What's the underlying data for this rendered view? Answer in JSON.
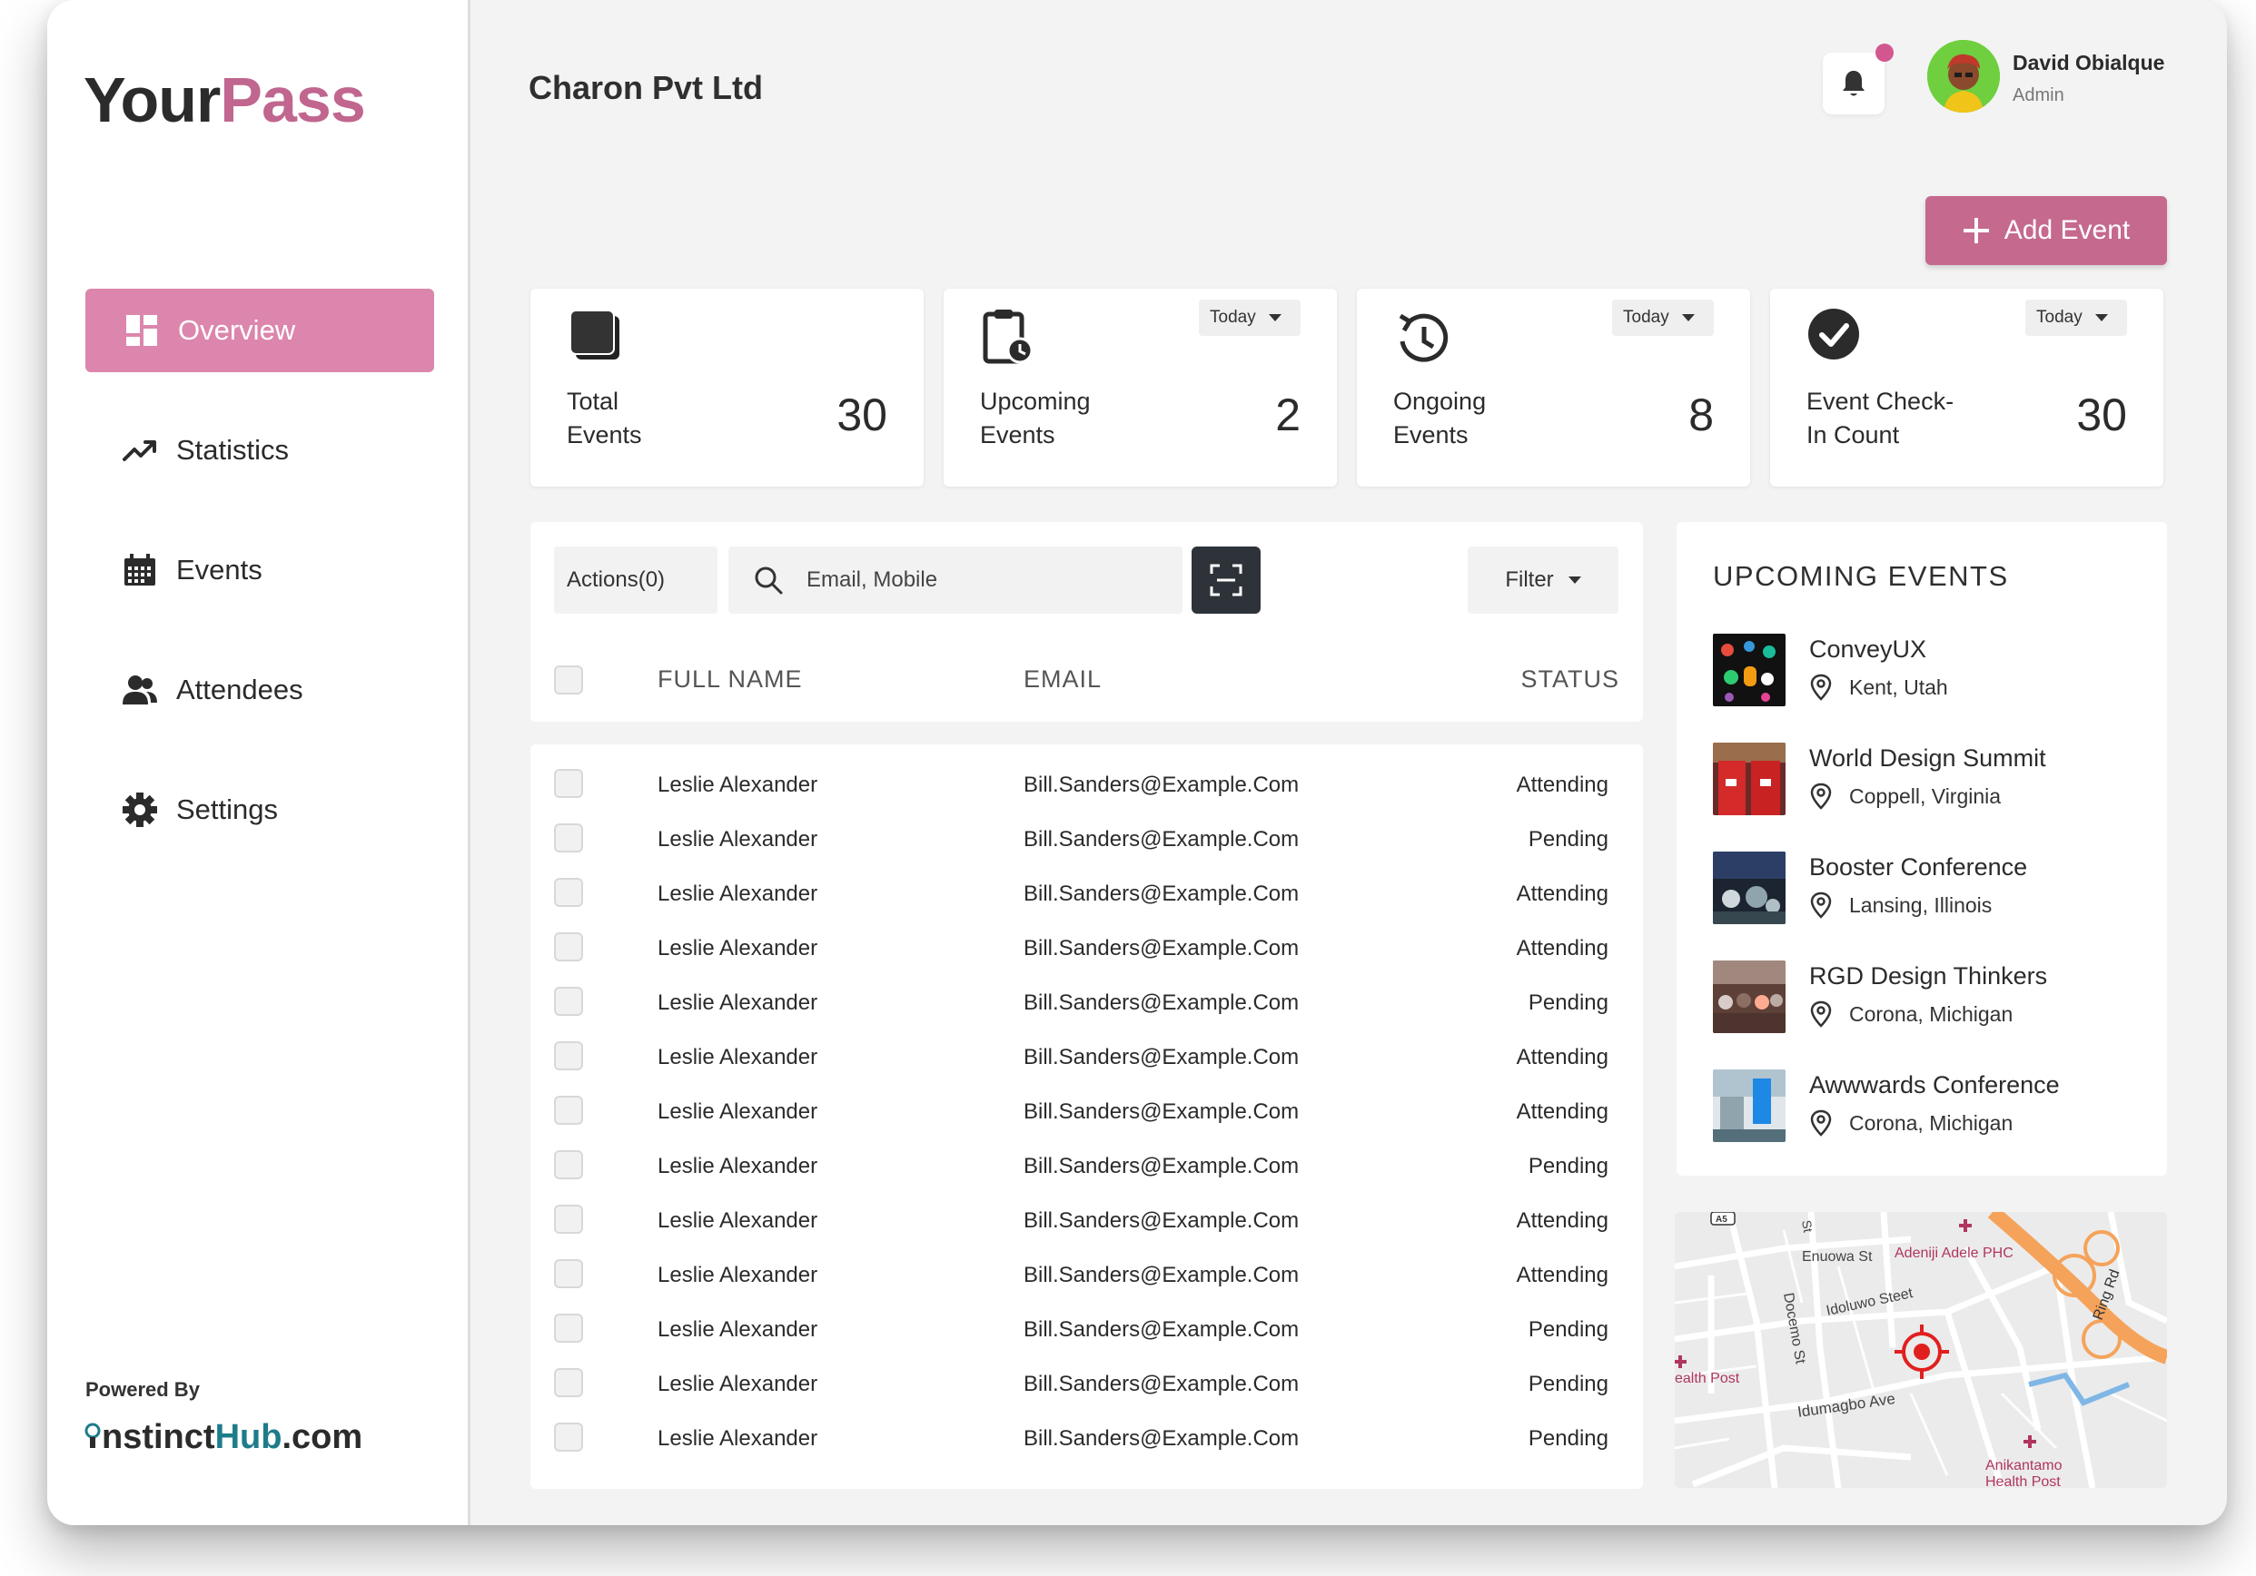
{
  "app": {
    "logo_part1": "Your",
    "logo_part2": "Pass",
    "company": "Charon Pvt Ltd",
    "powered_by": "Powered By",
    "brand_part1": "nstinct",
    "brand_part2": "Hub",
    "brand_part3": ".com"
  },
  "sidebar": {
    "items": [
      {
        "label": "Overview",
        "icon": "grid-icon",
        "active": true
      },
      {
        "label": "Statistics",
        "icon": "trend-up-icon"
      },
      {
        "label": "Events",
        "icon": "calendar-icon"
      },
      {
        "label": "Attendees",
        "icon": "people-icon"
      },
      {
        "label": "Settings",
        "icon": "gear-icon"
      }
    ]
  },
  "user": {
    "name": "David Obialque",
    "role": "Admin"
  },
  "add_event": {
    "label": "Add Event"
  },
  "stats": [
    {
      "label_line1": "Total",
      "label_line2": "Events",
      "value": "30",
      "icon": "square-stack-icon"
    },
    {
      "label_line1": "Upcoming",
      "label_line2": "Events",
      "value": "2",
      "icon": "clipboard-clock-icon",
      "period": "Today"
    },
    {
      "label_line1": "Ongoing",
      "label_line2": "Events",
      "value": "8",
      "icon": "clock-refresh-icon",
      "period": "Today"
    },
    {
      "label_line1": "Event Check-",
      "label_line2": "In Count",
      "value": "30",
      "icon": "check-circle-icon",
      "period": "Today"
    }
  ],
  "toolbar": {
    "actions_label": "Actions(0)",
    "search_placeholder": "Email, Mobile",
    "filter_label": "Filter"
  },
  "table": {
    "columns": [
      "FULL NAME",
      "EMAIL",
      "STATUS"
    ],
    "rows": [
      {
        "name": "Leslie Alexander",
        "email": "Bill.Sanders@Example.Com",
        "status": "Attending"
      },
      {
        "name": "Leslie Alexander",
        "email": "Bill.Sanders@Example.Com",
        "status": "Pending"
      },
      {
        "name": "Leslie Alexander",
        "email": "Bill.Sanders@Example.Com",
        "status": "Attending"
      },
      {
        "name": "Leslie Alexander",
        "email": "Bill.Sanders@Example.Com",
        "status": "Attending"
      },
      {
        "name": "Leslie Alexander",
        "email": "Bill.Sanders@Example.Com",
        "status": "Pending"
      },
      {
        "name": "Leslie Alexander",
        "email": "Bill.Sanders@Example.Com",
        "status": "Attending"
      },
      {
        "name": "Leslie Alexander",
        "email": "Bill.Sanders@Example.Com",
        "status": "Attending"
      },
      {
        "name": "Leslie Alexander",
        "email": "Bill.Sanders@Example.Com",
        "status": "Pending"
      },
      {
        "name": "Leslie Alexander",
        "email": "Bill.Sanders@Example.Com",
        "status": "Attending"
      },
      {
        "name": "Leslie Alexander",
        "email": "Bill.Sanders@Example.Com",
        "status": "Attending"
      },
      {
        "name": "Leslie Alexander",
        "email": "Bill.Sanders@Example.Com",
        "status": "Pending"
      },
      {
        "name": "Leslie Alexander",
        "email": "Bill.Sanders@Example.Com",
        "status": "Pending"
      },
      {
        "name": "Leslie Alexander",
        "email": "Bill.Sanders@Example.Com",
        "status": "Pending"
      }
    ]
  },
  "upcoming": {
    "title": "UPCOMING EVENTS",
    "events": [
      {
        "name": "ConveyUX",
        "location": "Kent, Utah"
      },
      {
        "name": "World Design Summit",
        "location": "Coppell, Virginia"
      },
      {
        "name": "Booster Conference",
        "location": "Lansing, Illinois"
      },
      {
        "name": "RGD Design Thinkers",
        "location": "Corona, Michigan"
      },
      {
        "name": "Awwwards Conference",
        "location": "Corona, Michigan"
      }
    ]
  },
  "map": {
    "labels": {
      "a5": "A5",
      "enuowa": "Enuowa St",
      "adeniji": "Adeniji Adele PHC",
      "idoluwo": "Idoluwo Steet",
      "ring": "Ring Rd",
      "docemo": "Docemo St",
      "health": "ealth Post",
      "idumagbo": "Idumagbo Ave",
      "anikantamo1": "Anikantamo",
      "anikantamo2": "Health Post",
      "st": "St"
    }
  },
  "colors": {
    "accent": "#dc86ad",
    "accent_dark": "#c5698f",
    "scan_btn": "#2d3339"
  }
}
